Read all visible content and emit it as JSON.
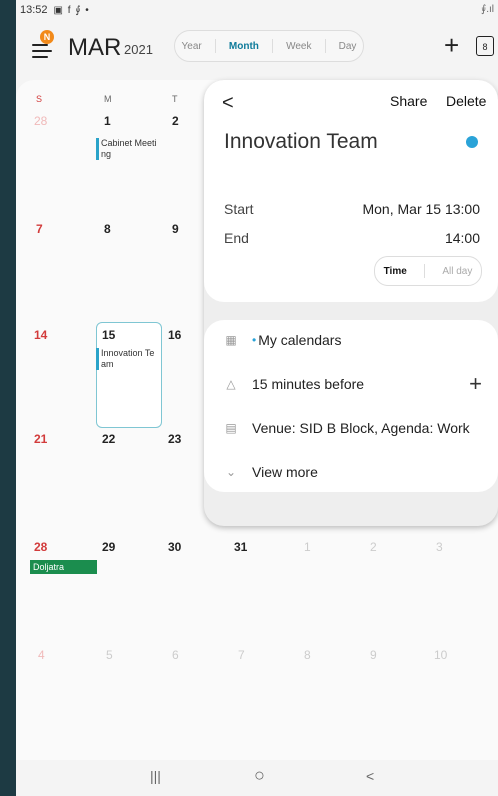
{
  "status_bar": {
    "time": "13:52",
    "icons": "▣ f ⨚ •",
    "right": "⨚.ıl"
  },
  "header": {
    "badge": "N",
    "month": "MAR",
    "year": "2021",
    "views": [
      "Year",
      "Month",
      "Week",
      "Day"
    ],
    "active_view": "Month",
    "add": "+",
    "today": "8"
  },
  "calendar": {
    "weekdays": [
      "S",
      "M",
      "T"
    ],
    "weeks": [
      [
        "28",
        "1",
        "2"
      ],
      [
        "7",
        "8",
        "9"
      ],
      [
        "14",
        "15",
        "16"
      ],
      [
        "21",
        "22",
        "23"
      ],
      [
        "28",
        "29",
        "30",
        "31",
        "1",
        "2",
        "3"
      ],
      [
        "4",
        "5",
        "6",
        "7",
        "8",
        "9",
        "10"
      ]
    ],
    "events": {
      "cabinet": "Cabinet Meeting",
      "innovation": "Innovation Team",
      "holiday": "Doljatra"
    }
  },
  "popup": {
    "back": "<",
    "share": "Share",
    "delete": "Delete",
    "title": "Innovation Team",
    "start_label": "Start",
    "start_value": "Mon, Mar 15  13:00",
    "end_label": "End",
    "end_value": "14:00",
    "time_label": "Time",
    "allday_label": "All day",
    "calendar_label": "My calendars",
    "reminder": "15 minutes before",
    "reminder_add": "+",
    "notes": "Venue: SID B Block, Agenda: Work",
    "view_more": "View more"
  },
  "nav": {
    "recent": "|||",
    "home": "○",
    "back": "<"
  },
  "colors": {
    "accent": "#0d7a9a",
    "event_dot": "#2aa3d8",
    "holiday": "#1b8d4e",
    "sunday": "#d23b3b",
    "badge": "#f28a1a"
  }
}
